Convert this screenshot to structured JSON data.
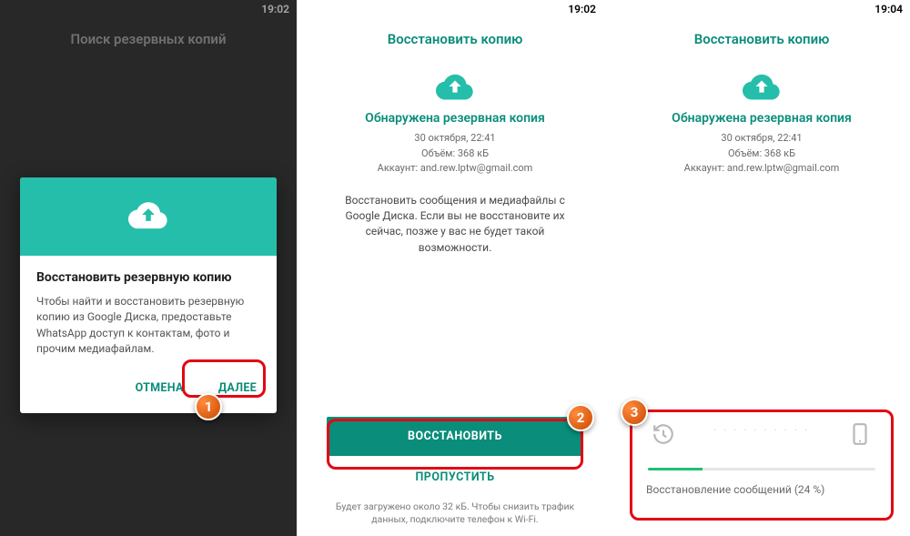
{
  "colors": {
    "accent": "#0a8d7a",
    "accent_light": "#25beaa",
    "callout": "#e30613"
  },
  "screen1": {
    "time": "19:02",
    "title": "Поиск резервных копий",
    "dialog": {
      "heading": "Восстановить резервную копию",
      "body": "Чтобы найти и восстановить резервную копию из Google Диска, предоставьте WhatsApp доступ к контактам, фото и прочим медиафайлам.",
      "cancel": "ОТМЕНА",
      "next": "ДАЛЕЕ"
    },
    "marker": "1"
  },
  "screen2": {
    "time": "19:02",
    "title": "Восстановить копию",
    "found": "Обнаружена резервная копия",
    "meta_date": "30 октября, 22:41",
    "meta_size": "Объём: 368 кБ",
    "meta_account": "Аккаунт: and.rew.lptw@gmail.com",
    "explain": "Восстановить сообщения и медиафайлы с Google Диска. Если вы не восстановите их сейчас, позже у вас не будет такой возможности.",
    "restore": "ВОССТАНОВИТЬ",
    "skip": "ПРОПУСТИТЬ",
    "footnote": "Будет загружено около 32 кБ. Чтобы снизить трафик данных, подключите телефон к Wi-Fi.",
    "marker": "2"
  },
  "screen3": {
    "time": "19:04",
    "title": "Восстановить копию",
    "found": "Обнаружена резервная копия",
    "meta_date": "30 октября, 22:41",
    "meta_size": "Объём: 368 кБ",
    "meta_account": "Аккаунт: and.rew.lptw@gmail.com",
    "progress_pct": 24,
    "progress_label": "Восстановление сообщений (24 %)",
    "marker": "3"
  }
}
